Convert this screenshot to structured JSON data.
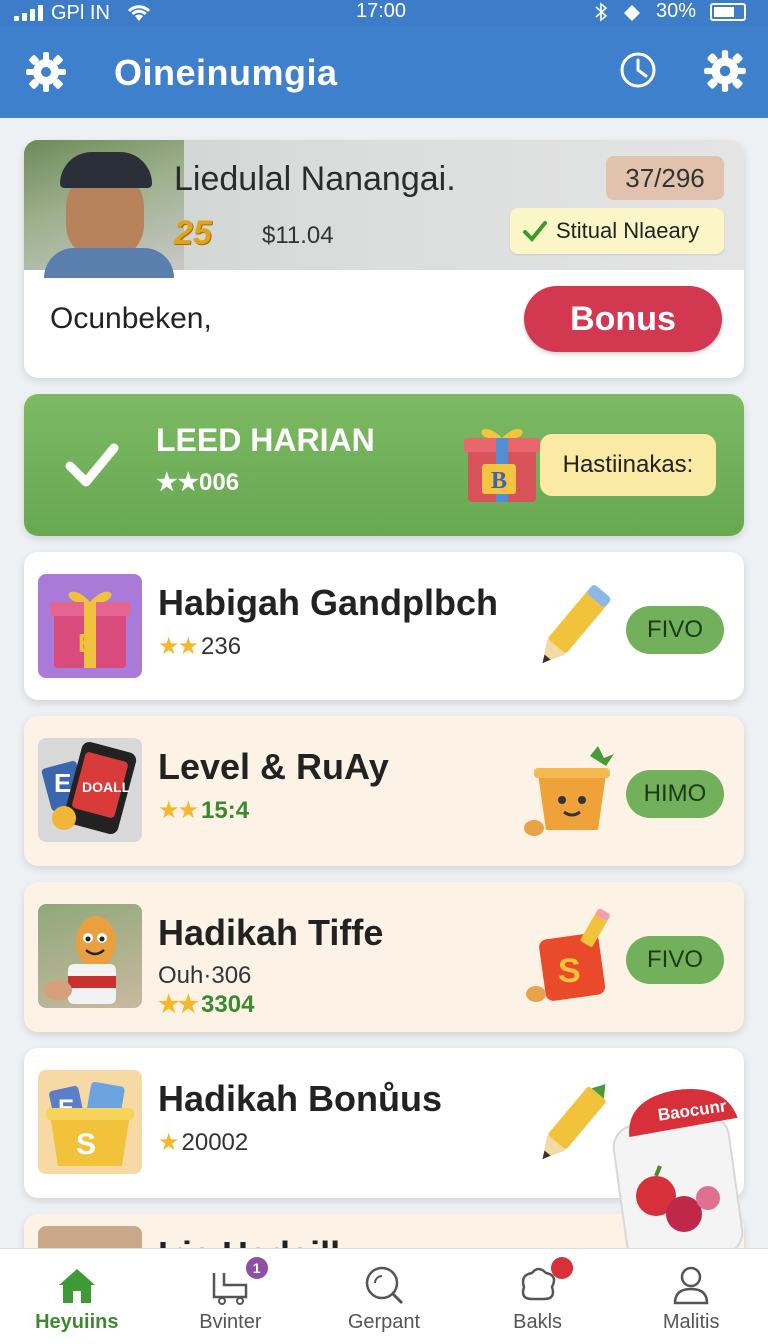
{
  "status_bar": {
    "carrier": "GPl IN",
    "time": "17:00",
    "battery": "30%"
  },
  "header": {
    "title": "Oineinumgia"
  },
  "profile": {
    "name": "Liedulal Nanangai.",
    "points": "25",
    "amount": "$11.04",
    "count": "37/296",
    "status": "Stitual Nlaeary",
    "label": "Ocunbeken,",
    "bonus_label": "Bonus"
  },
  "daily": {
    "title": "LEED HARIAN",
    "stars": "★★",
    "value": "006",
    "bubble": "Hastiinakas:"
  },
  "items": [
    {
      "name": "Habigah Gandplbch",
      "stars": "★★",
      "value": "236",
      "button": "FIVO"
    },
    {
      "name": "Level & RuAy",
      "stars": "★★",
      "value": "15:4",
      "button": "HIMO"
    },
    {
      "name": "Hadikah Tiffe",
      "sub": "Ouh·306",
      "stars": "★★",
      "value": "3304",
      "button": "FIVO"
    },
    {
      "name": "Hadikah Bonůus",
      "stars": "★",
      "value": "20002"
    }
  ],
  "partial_item": {
    "name": "Iris Hadsill"
  },
  "promo": {
    "label": "Baocunr"
  },
  "nav": [
    {
      "label": "Heyuiins",
      "active": true
    },
    {
      "label": "Bvinter",
      "badge": "1"
    },
    {
      "label": "Gerpant"
    },
    {
      "label": "Bakls",
      "badge": ""
    },
    {
      "label": "Malitis"
    }
  ],
  "colors": {
    "header": "#3f80cc",
    "accent_red": "#d23850",
    "green": "#73b05b",
    "gold": "#e2a31c"
  }
}
